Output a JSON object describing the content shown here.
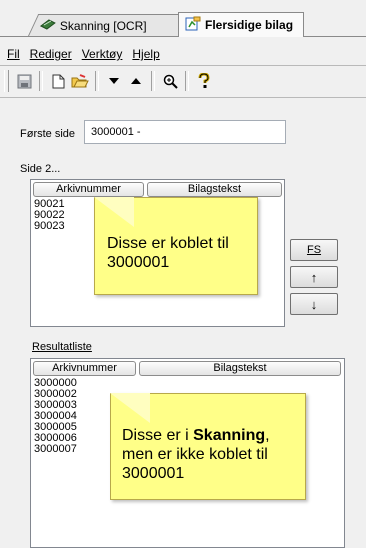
{
  "tabs": [
    {
      "label": "Skanning  [OCR]",
      "icon": "scanner-icon"
    },
    {
      "label": "Flersidige bilag",
      "icon": "document-icon"
    }
  ],
  "menu": {
    "fil": "Fil",
    "rediger": "Rediger",
    "verktoy": "Verktøy",
    "hjelp": "Hjelp"
  },
  "toolbar": {
    "icons": [
      "save-icon",
      "new-document-icon",
      "open-folder-icon",
      "arrow-down-icon",
      "arrow-up-icon",
      "zoom-icon",
      "help-icon"
    ]
  },
  "form": {
    "forste_side_label": "Første side",
    "forste_side_value": "3000001 -",
    "side_label": "Side 2...",
    "resultat_label": "Resultatliste"
  },
  "list_top": {
    "columns": [
      "Arkivnummer",
      "Bilagstekst"
    ],
    "rows": [
      "90021",
      "90022",
      "90023"
    ]
  },
  "list_bottom": {
    "columns": [
      "Arkivnummer",
      "Bilagstekst"
    ],
    "rows": [
      "3000000",
      "3000002",
      "3000003",
      "3000004",
      "3000005",
      "3000006",
      "3000007"
    ]
  },
  "side_buttons": {
    "fs": "FS",
    "up": "↑",
    "down": "↓"
  },
  "notes": {
    "top": "Disse er koblet til 3000001",
    "bottom_pre": "Disse er i ",
    "bottom_bold": "Skanning",
    "bottom_post": ", men er ikke koblet til 3000001"
  }
}
